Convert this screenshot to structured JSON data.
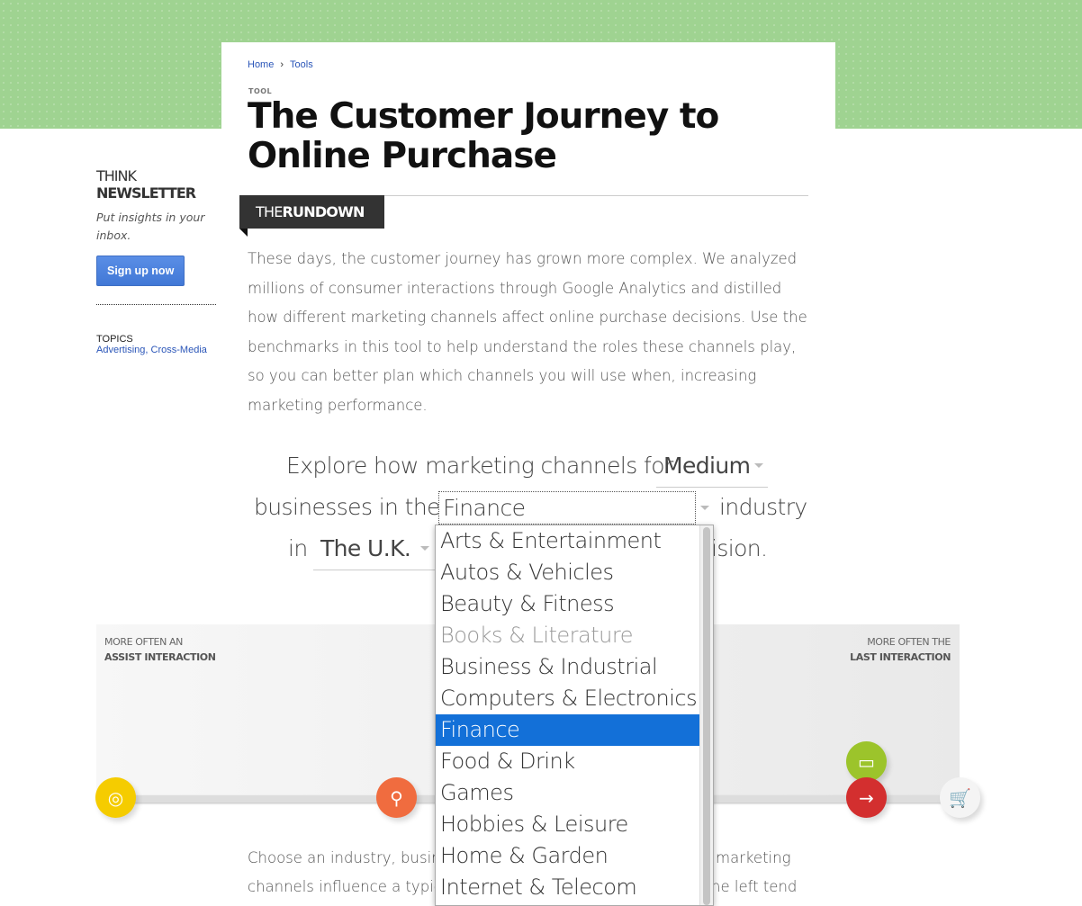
{
  "breadcrumb": {
    "home": "Home",
    "sep": "›",
    "tools": "Tools"
  },
  "eyebrow": "TOOL",
  "title": "The Customer Journey to Online Purchase",
  "rundown": {
    "the": "THE",
    "rundown": "RUNDOWN"
  },
  "intro": "These days, the customer journey has grown more complex. We analyzed millions of consumer interactions through Google Analytics and distilled how different marketing channels affect online purchase decisions. Use the benchmarks in this tool to help understand the roles these channels play, so you can better plan which channels you will use when, increasing marketing performance.",
  "sidebar": {
    "think": "THINK",
    "newsletter": "NEWSLETTER",
    "tagline": "Put insights in your inbox.",
    "signup": "Sign up now",
    "topics_label": "TOPICS",
    "topics": "Advertising, Cross-Media"
  },
  "explore": {
    "s1": "Explore how marketing channels for",
    "size": "Medium",
    "s2": "businesses in the",
    "industry": "Finance",
    "s3": "industry",
    "s4": "in",
    "country": "The U.K.",
    "s5": "ision."
  },
  "industry_options": [
    "Arts & Entertainment",
    "Autos & Vehicles",
    "Beauty & Fitness",
    "Books & Literature",
    "Business & Industrial",
    "Computers & Electronics",
    "Finance",
    "Food & Drink",
    "Games",
    "Hobbies & Leisure",
    "Home & Garden",
    "Internet & Telecom"
  ],
  "selected_industry": "Finance",
  "disabled_option": "Books & Literature",
  "chart": {
    "left_top": "MORE OFTEN AN",
    "left_bottom": "ASSIST INTERACTION",
    "right_top": "MORE OFTEN THE",
    "right_bottom": "LAST INTERACTION",
    "channels": [
      {
        "icon": "display-icon",
        "color": "#f5cc00"
      },
      {
        "icon": "search-icon",
        "color": "#f06c3f"
      },
      {
        "icon": "social-icon",
        "color": "#9cc42b"
      },
      {
        "icon": "direct-icon",
        "color": "#d32f2f"
      },
      {
        "icon": "cart-icon",
        "color": "#f4f4f4"
      }
    ]
  },
  "bottom": {
    "l1a": "Choose an industry, busin",
    "l1b": "marketing",
    "l2a": "channels influence a typic",
    "l2b": "he left tend"
  }
}
